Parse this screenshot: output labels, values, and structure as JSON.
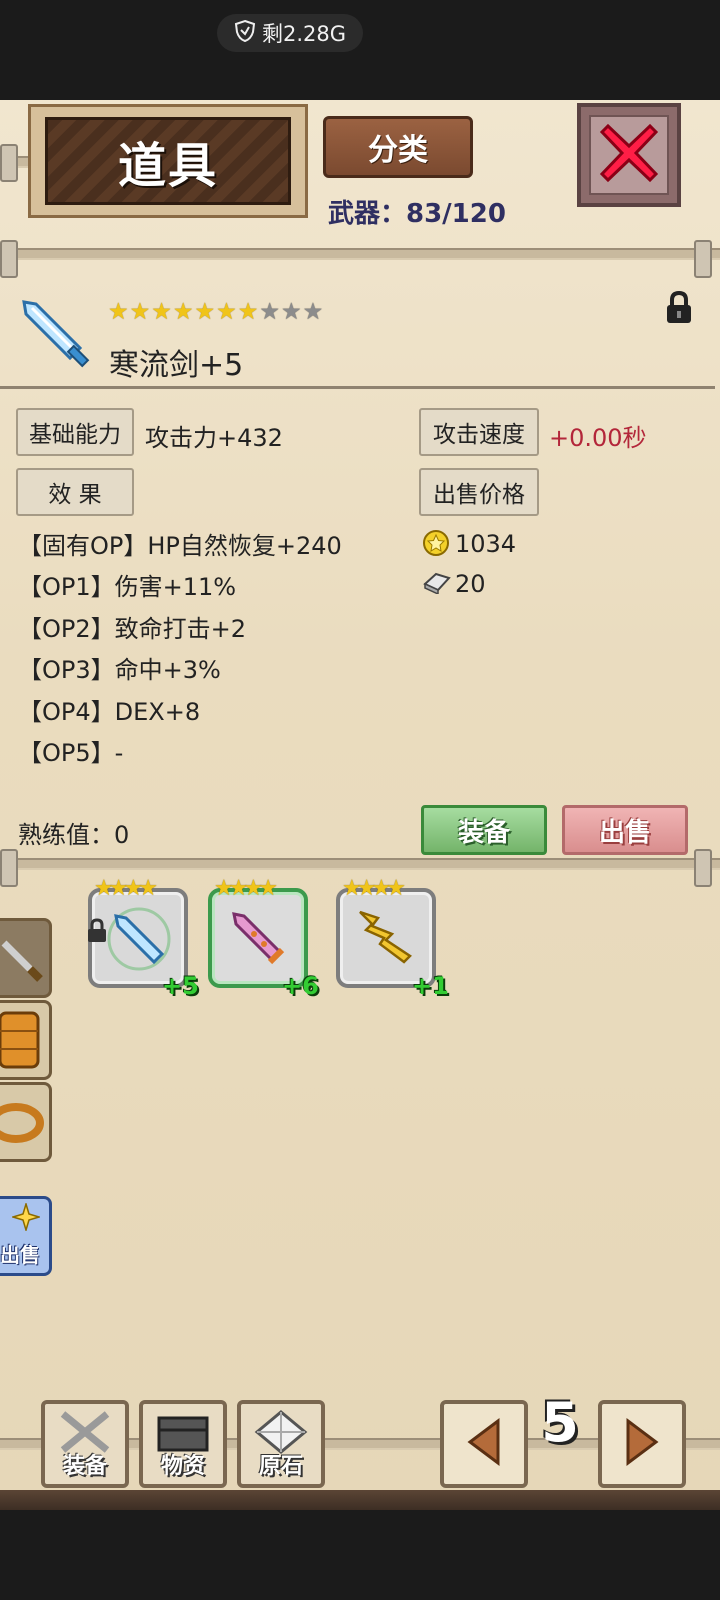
{
  "status": {
    "data_remaining": "剩2.28G"
  },
  "header": {
    "title": "道具",
    "sort_label": "分类",
    "weapon_count": "武器：83/120"
  },
  "item": {
    "name": "寒流剑+5",
    "stars_filled": 7,
    "stars_total": 10,
    "base_label": "基础能力",
    "attack": "攻击力+432",
    "speed_label": "攻击速度",
    "speed_value": "+0.00秒",
    "effect_label": "效 果",
    "price_label": "出售价格",
    "options": [
      "【固有OP】HP自然恢复+240",
      "【OP1】伤害+11%",
      "【OP2】致命打击+2",
      "【OP3】命中+3%",
      "【OP4】DEX+8",
      "【OP5】-"
    ],
    "price_gold": "1034",
    "price_silver": "20",
    "proficiency": "熟练值：0",
    "equip_label": "装备",
    "sell_label": "出售"
  },
  "inventory": [
    {
      "plus": "+5"
    },
    {
      "plus": "+6"
    },
    {
      "plus": "+1"
    }
  ],
  "side": {
    "bulk_sell_text": "出售"
  },
  "bottom": {
    "equip": "装备",
    "materials": "物资",
    "ore": "原石",
    "page": "5"
  },
  "colors": {
    "accent_red": "#b3263a",
    "weapon_count": "#2f2f62"
  }
}
